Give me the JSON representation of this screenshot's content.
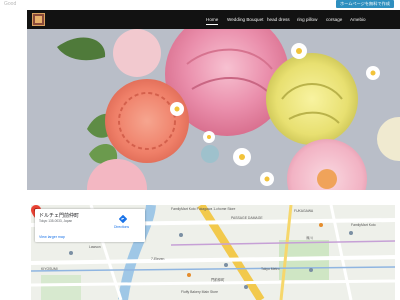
{
  "topbar": {
    "label": "Good",
    "cta_label": "ホームページを無料で作成"
  },
  "nav": {
    "items": [
      {
        "label": "Home"
      },
      {
        "label": "Wedding Bouquet"
      },
      {
        "label": "head dress"
      },
      {
        "label": "ring pillow"
      },
      {
        "label": "corsage"
      },
      {
        "label": "Amebio"
      }
    ]
  },
  "map": {
    "place_name": "ドルチェ門前仲町",
    "address": "Tokyo 135-0033, Japan",
    "view_larger": "View larger map",
    "directions": "Directions",
    "labels": [
      "FamilyMart Koto Fukagawa 1-chome Store",
      "PASSAGE DAMAGE",
      "FUKAGAWA",
      "Lawson",
      "FamilyMart Koto",
      "7-Eleven",
      "Tokyo Metro",
      "深川",
      "KIYOSUMI",
      "門前仲町",
      "Fluffy Bakery Main Store"
    ]
  },
  "colors": {
    "nav_bg": "#121212",
    "cta_bg": "#2e8fbf",
    "link": "#1a73e8",
    "pin": "#ea4335"
  }
}
